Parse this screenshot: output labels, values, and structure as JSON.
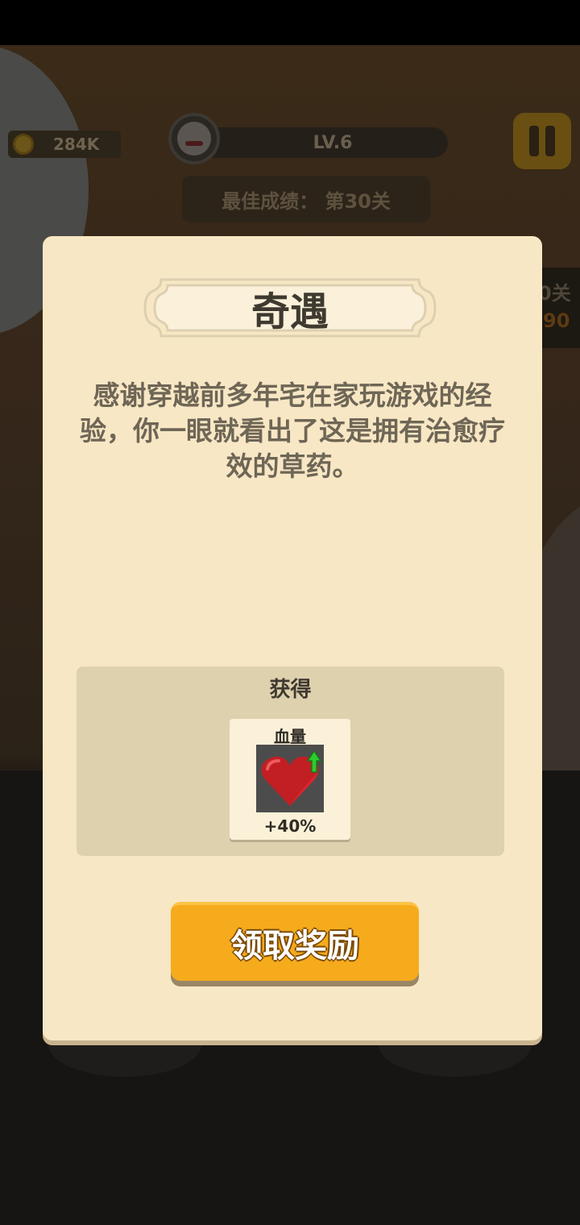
{
  "hud": {
    "coins": "284K",
    "level": "LV.6",
    "best_score": "最佳成绩： 第30关",
    "side_level": "0关",
    "side_level_sub": "90"
  },
  "dialog": {
    "title": "奇遇",
    "message": "感谢穿越前多年宅在家玩游戏的经验，你一眼就看出了这是拥有治愈疗效的草药。",
    "reward_header": "获得",
    "reward": {
      "name": "血量",
      "icon": "heart-icon",
      "value": "+40%"
    },
    "claim_label": "领取奖励"
  },
  "colors": {
    "dialog_bg": "#f8e7c4",
    "button": "#f6ab1c",
    "heart": "#d8262b",
    "arrow": "#2ecc2e"
  }
}
